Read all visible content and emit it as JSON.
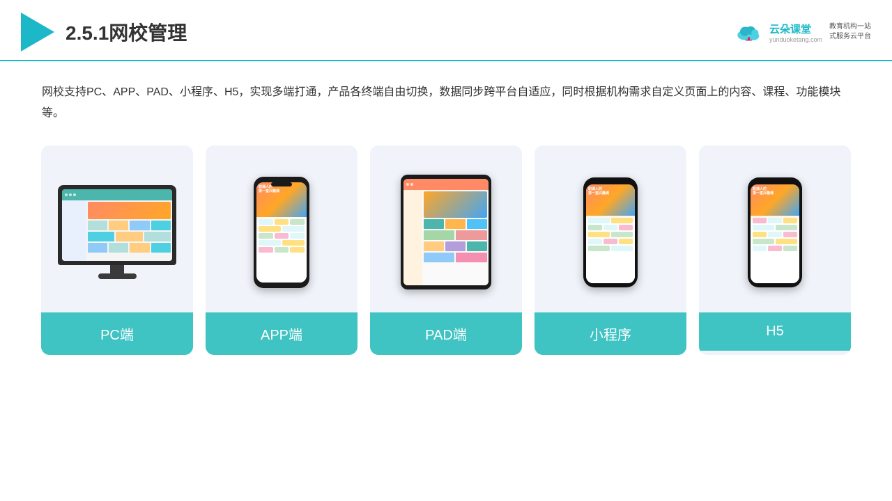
{
  "header": {
    "title": "2.5.1网校管理",
    "brand": {
      "name": "云朵课堂",
      "url": "yunduoketang.com",
      "slogan": "教育机构一站\n式服务云平台"
    }
  },
  "description": "网校支持PC、APP、PAD、小程序、H5，实现多端打通，产品各终端自由切换，数据同步跨平台自适应，同时根据机构需求自定义页面上的内容、课程、功能模块等。",
  "cards": [
    {
      "id": "pc",
      "label": "PC端"
    },
    {
      "id": "app",
      "label": "APP端"
    },
    {
      "id": "pad",
      "label": "PAD端"
    },
    {
      "id": "mini",
      "label": "小程序"
    },
    {
      "id": "h5",
      "label": "H5"
    }
  ]
}
